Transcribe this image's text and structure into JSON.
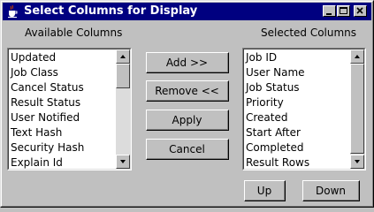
{
  "window": {
    "title": "Select Columns for Display",
    "icons": [
      "java-cup-icon",
      "minimize-icon",
      "maximize-icon",
      "close-icon"
    ]
  },
  "available": {
    "label": "Available Columns",
    "items": [
      "Updated",
      "Job Class",
      "Cancel Status",
      "Result Status",
      "User Notified",
      "Text Hash",
      "Security Hash",
      "Explain Id"
    ]
  },
  "selected": {
    "label": "Selected Columns",
    "items": [
      "Job ID",
      "User Name",
      "Job Status",
      "Priority",
      "Created",
      "Start After",
      "Completed",
      "Result Rows"
    ]
  },
  "buttons": {
    "add": "Add >>",
    "remove": "Remove <<",
    "apply": "Apply",
    "cancel": "Cancel",
    "up": "Up",
    "down": "Down"
  }
}
